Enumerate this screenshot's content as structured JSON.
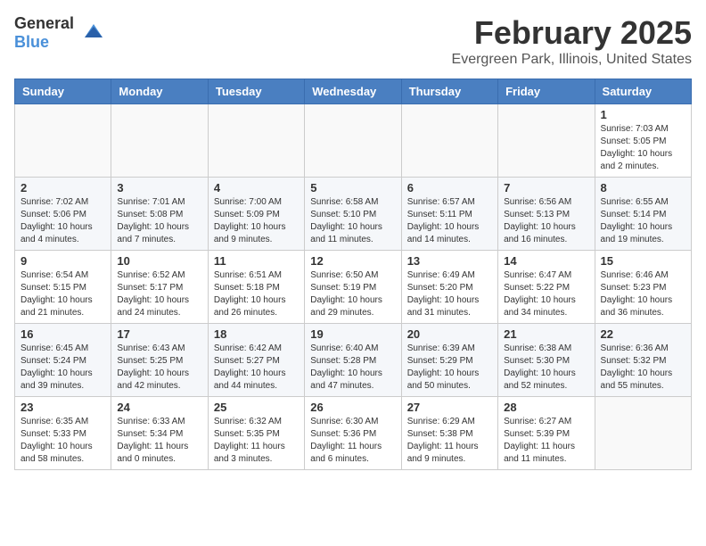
{
  "header": {
    "logo_general": "General",
    "logo_blue": "Blue",
    "title": "February 2025",
    "location": "Evergreen Park, Illinois, United States"
  },
  "weekdays": [
    "Sunday",
    "Monday",
    "Tuesday",
    "Wednesday",
    "Thursday",
    "Friday",
    "Saturday"
  ],
  "weeks": [
    [
      {
        "day": "",
        "content": ""
      },
      {
        "day": "",
        "content": ""
      },
      {
        "day": "",
        "content": ""
      },
      {
        "day": "",
        "content": ""
      },
      {
        "day": "",
        "content": ""
      },
      {
        "day": "",
        "content": ""
      },
      {
        "day": "1",
        "content": "Sunrise: 7:03 AM\nSunset: 5:05 PM\nDaylight: 10 hours\nand 2 minutes."
      }
    ],
    [
      {
        "day": "2",
        "content": "Sunrise: 7:02 AM\nSunset: 5:06 PM\nDaylight: 10 hours\nand 4 minutes."
      },
      {
        "day": "3",
        "content": "Sunrise: 7:01 AM\nSunset: 5:08 PM\nDaylight: 10 hours\nand 7 minutes."
      },
      {
        "day": "4",
        "content": "Sunrise: 7:00 AM\nSunset: 5:09 PM\nDaylight: 10 hours\nand 9 minutes."
      },
      {
        "day": "5",
        "content": "Sunrise: 6:58 AM\nSunset: 5:10 PM\nDaylight: 10 hours\nand 11 minutes."
      },
      {
        "day": "6",
        "content": "Sunrise: 6:57 AM\nSunset: 5:11 PM\nDaylight: 10 hours\nand 14 minutes."
      },
      {
        "day": "7",
        "content": "Sunrise: 6:56 AM\nSunset: 5:13 PM\nDaylight: 10 hours\nand 16 minutes."
      },
      {
        "day": "8",
        "content": "Sunrise: 6:55 AM\nSunset: 5:14 PM\nDaylight: 10 hours\nand 19 minutes."
      }
    ],
    [
      {
        "day": "9",
        "content": "Sunrise: 6:54 AM\nSunset: 5:15 PM\nDaylight: 10 hours\nand 21 minutes."
      },
      {
        "day": "10",
        "content": "Sunrise: 6:52 AM\nSunset: 5:17 PM\nDaylight: 10 hours\nand 24 minutes."
      },
      {
        "day": "11",
        "content": "Sunrise: 6:51 AM\nSunset: 5:18 PM\nDaylight: 10 hours\nand 26 minutes."
      },
      {
        "day": "12",
        "content": "Sunrise: 6:50 AM\nSunset: 5:19 PM\nDaylight: 10 hours\nand 29 minutes."
      },
      {
        "day": "13",
        "content": "Sunrise: 6:49 AM\nSunset: 5:20 PM\nDaylight: 10 hours\nand 31 minutes."
      },
      {
        "day": "14",
        "content": "Sunrise: 6:47 AM\nSunset: 5:22 PM\nDaylight: 10 hours\nand 34 minutes."
      },
      {
        "day": "15",
        "content": "Sunrise: 6:46 AM\nSunset: 5:23 PM\nDaylight: 10 hours\nand 36 minutes."
      }
    ],
    [
      {
        "day": "16",
        "content": "Sunrise: 6:45 AM\nSunset: 5:24 PM\nDaylight: 10 hours\nand 39 minutes."
      },
      {
        "day": "17",
        "content": "Sunrise: 6:43 AM\nSunset: 5:25 PM\nDaylight: 10 hours\nand 42 minutes."
      },
      {
        "day": "18",
        "content": "Sunrise: 6:42 AM\nSunset: 5:27 PM\nDaylight: 10 hours\nand 44 minutes."
      },
      {
        "day": "19",
        "content": "Sunrise: 6:40 AM\nSunset: 5:28 PM\nDaylight: 10 hours\nand 47 minutes."
      },
      {
        "day": "20",
        "content": "Sunrise: 6:39 AM\nSunset: 5:29 PM\nDaylight: 10 hours\nand 50 minutes."
      },
      {
        "day": "21",
        "content": "Sunrise: 6:38 AM\nSunset: 5:30 PM\nDaylight: 10 hours\nand 52 minutes."
      },
      {
        "day": "22",
        "content": "Sunrise: 6:36 AM\nSunset: 5:32 PM\nDaylight: 10 hours\nand 55 minutes."
      }
    ],
    [
      {
        "day": "23",
        "content": "Sunrise: 6:35 AM\nSunset: 5:33 PM\nDaylight: 10 hours\nand 58 minutes."
      },
      {
        "day": "24",
        "content": "Sunrise: 6:33 AM\nSunset: 5:34 PM\nDaylight: 11 hours\nand 0 minutes."
      },
      {
        "day": "25",
        "content": "Sunrise: 6:32 AM\nSunset: 5:35 PM\nDaylight: 11 hours\nand 3 minutes."
      },
      {
        "day": "26",
        "content": "Sunrise: 6:30 AM\nSunset: 5:36 PM\nDaylight: 11 hours\nand 6 minutes."
      },
      {
        "day": "27",
        "content": "Sunrise: 6:29 AM\nSunset: 5:38 PM\nDaylight: 11 hours\nand 9 minutes."
      },
      {
        "day": "28",
        "content": "Sunrise: 6:27 AM\nSunset: 5:39 PM\nDaylight: 11 hours\nand 11 minutes."
      },
      {
        "day": "",
        "content": ""
      }
    ]
  ]
}
